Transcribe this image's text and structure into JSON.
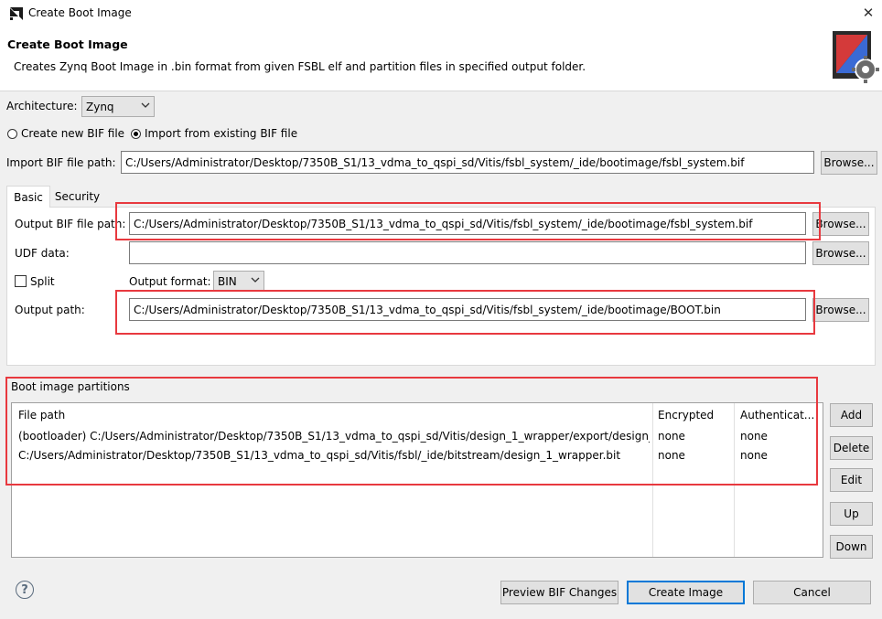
{
  "window": {
    "title": "Create Boot Image",
    "close_glyph": "✕"
  },
  "header": {
    "title": "Create Boot Image",
    "description": "Creates Zynq Boot Image in .bin format from given FSBL elf and partition files in specified output folder.",
    "icon": "boot-image-gear-icon"
  },
  "architecture": {
    "label": "Architecture:",
    "value": "Zynq"
  },
  "mode": {
    "create_new": "Create new BIF file",
    "import_existing": "Import from existing BIF file",
    "selected": "import_existing"
  },
  "import_bif": {
    "label": "Import BIF file path:",
    "value": "C:/Users/Administrator/Desktop/7350B_S1/13_vdma_to_qspi_sd/Vitis/fsbl_system/_ide/bootimage/fsbl_system.bif",
    "browse": "Browse..."
  },
  "tabs": {
    "basic": "Basic",
    "security": "Security"
  },
  "basic": {
    "output_bif_label": "Output BIF file path:",
    "output_bif_value": "C:/Users/Administrator/Desktop/7350B_S1/13_vdma_to_qspi_sd/Vitis/fsbl_system/_ide/bootimage/fsbl_system.bif",
    "udf_label": "UDF data:",
    "udf_value": "",
    "split_label": "Split",
    "output_format_label": "Output format:",
    "output_format_value": "BIN",
    "output_path_label": "Output path:",
    "output_path_value": "C:/Users/Administrator/Desktop/7350B_S1/13_vdma_to_qspi_sd/Vitis/fsbl_system/_ide/bootimage/BOOT.bin",
    "browse": "Browse..."
  },
  "partitions": {
    "section_label": "Boot image partitions",
    "columns": [
      "File path",
      "Encrypted",
      "Authenticat..."
    ],
    "rows": [
      [
        "(bootloader) C:/Users/Administrator/Desktop/7350B_S1/13_vdma_to_qspi_sd/Vitis/design_1_wrapper/export/design_...",
        "none",
        "none"
      ],
      [
        "C:/Users/Administrator/Desktop/7350B_S1/13_vdma_to_qspi_sd/Vitis/fsbl/_ide/bitstream/design_1_wrapper.bit",
        "none",
        "none"
      ]
    ],
    "buttons": {
      "add": "Add",
      "delete": "Delete",
      "edit": "Edit",
      "up": "Up",
      "down": "Down"
    }
  },
  "footer": {
    "help": "?",
    "preview": "Preview BIF Changes",
    "create": "Create Image",
    "cancel": "Cancel"
  },
  "colors": {
    "highlight_box": "#e8393f",
    "default_button_border": "#0078d7"
  }
}
